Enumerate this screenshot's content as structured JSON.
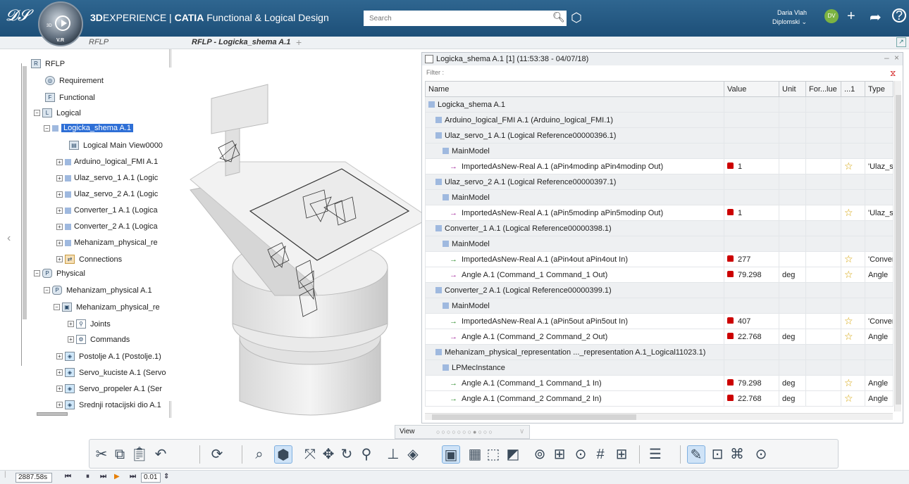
{
  "topbar": {
    "ds_logo": "3DS",
    "brand_bold": "3D",
    "brand_rest": "EXPERIENCE | ",
    "product_bold": "CATIA",
    "product_rest": " Functional & Logical Design",
    "search_placeholder": "Search",
    "user_name": "Daria Vlah",
    "user_space": "Diplomski ⌄",
    "avatar_initials": "DV",
    "compass_label": "V.R",
    "compass_3d": "3D"
  },
  "tabs": [
    {
      "label": "RFLP"
    },
    {
      "label": "RFLP - Logicka_shema A.1"
    }
  ],
  "tree": {
    "items": [
      {
        "label": "RFLP"
      },
      {
        "label": "Requirement"
      },
      {
        "label": "Functional"
      },
      {
        "label": "Logical"
      },
      {
        "label": "Logicka_shema A.1"
      },
      {
        "label": "Logical Main View0000"
      },
      {
        "label": "Arduino_logical_FMI A.1"
      },
      {
        "label": "Ulaz_servo_1 A.1 (Logic"
      },
      {
        "label": "Ulaz_servo_2 A.1 (Logic"
      },
      {
        "label": "Converter_1 A.1 (Logica"
      },
      {
        "label": "Converter_2 A.1 (Logica"
      },
      {
        "label": "Mehanizam_physical_re"
      },
      {
        "label": "Connections"
      },
      {
        "label": "Physical"
      },
      {
        "label": "Mehanizam_physical A.1"
      },
      {
        "label": "Mehanizam_physical_re"
      },
      {
        "label": "Joints"
      },
      {
        "label": "Commands"
      },
      {
        "label": "Postolje A.1 (Postolje.1)"
      },
      {
        "label": "Servo_kuciste A.1 (Servo"
      },
      {
        "label": "Servo_propeler A.1 (Ser"
      },
      {
        "label": "Srednji rotacijski dio A.1"
      }
    ]
  },
  "panel": {
    "title": "Logicka_shema A.1 [1] (11:53:38 - 04/07/18)",
    "filter_placeholder": "Filter :",
    "columns": [
      "Name",
      "Value",
      "Unit",
      "For...lue",
      "...1",
      "Type"
    ],
    "rows": [
      {
        "name": "Logicka_shema A.1",
        "value": "",
        "unit": "",
        "type": "",
        "kind": "grp"
      },
      {
        "name": "Arduino_logical_FMI A.1 (Arduino_logical_FMI.1)",
        "value": "",
        "unit": "",
        "type": "",
        "kind": "grp"
      },
      {
        "name": "Ulaz_servo_1 A.1 (Logical Reference00000396.1)",
        "value": "",
        "unit": "",
        "type": "",
        "kind": "grp"
      },
      {
        "name": "MainModel",
        "value": "",
        "unit": "",
        "type": "",
        "kind": "grp"
      },
      {
        "name": "ImportedAsNew-Real A.1 (aPin4modinp aPin4modinp Out)",
        "value": "1",
        "unit": "",
        "type": "'Ulaz_se",
        "kind": "out"
      },
      {
        "name": "Ulaz_servo_2 A.1 (Logical Reference00000397.1)",
        "value": "",
        "unit": "",
        "type": "",
        "kind": "grp"
      },
      {
        "name": "MainModel",
        "value": "",
        "unit": "",
        "type": "",
        "kind": "grp"
      },
      {
        "name": "ImportedAsNew-Real A.1 (aPin5modinp aPin5modinp Out)",
        "value": "1",
        "unit": "",
        "type": "'Ulaz_se",
        "kind": "out"
      },
      {
        "name": "Converter_1 A.1 (Logical Reference00000398.1)",
        "value": "",
        "unit": "",
        "type": "",
        "kind": "grp"
      },
      {
        "name": "MainModel",
        "value": "",
        "unit": "",
        "type": "",
        "kind": "grp"
      },
      {
        "name": "ImportedAsNew-Real A.1 (aPin4out aPin4out In)",
        "value": "277",
        "unit": "",
        "type": "'Conver",
        "kind": "in"
      },
      {
        "name": "Angle A.1 (Command_1 Command_1 Out)",
        "value": "79.298",
        "unit": "deg",
        "type": "Angle",
        "kind": "out"
      },
      {
        "name": "Converter_2 A.1 (Logical Reference00000399.1)",
        "value": "",
        "unit": "",
        "type": "",
        "kind": "grp"
      },
      {
        "name": "MainModel",
        "value": "",
        "unit": "",
        "type": "",
        "kind": "grp"
      },
      {
        "name": "ImportedAsNew-Real A.1 (aPin5out aPin5out In)",
        "value": "407",
        "unit": "",
        "type": "'Conver",
        "kind": "in"
      },
      {
        "name": "Angle A.1 (Command_2 Command_2 Out)",
        "value": "22.768",
        "unit": "deg",
        "type": "Angle",
        "kind": "out"
      },
      {
        "name": "Mehanizam_physical_representation ..._representation A.1_Logical11023.1)",
        "value": "",
        "unit": "",
        "type": "",
        "kind": "grp"
      },
      {
        "name": "LPMecInstance",
        "value": "",
        "unit": "",
        "type": "",
        "kind": "grp"
      },
      {
        "name": "Angle A.1 (Command_1 Command_1 In)",
        "value": "79.298",
        "unit": "deg",
        "type": "Angle",
        "kind": "in"
      },
      {
        "name": "Angle A.1 (Command_2 Command_2 In)",
        "value": "22.768",
        "unit": "deg",
        "type": "Angle",
        "kind": "in"
      }
    ]
  },
  "viewtab": {
    "label": "View"
  },
  "status": {
    "time": "2887.58s",
    "step": "0.01"
  },
  "icons": {
    "search": "search-icon",
    "tag": "tag-icon",
    "plus": "plus-icon",
    "share": "share-icon",
    "help": "help-icon"
  }
}
